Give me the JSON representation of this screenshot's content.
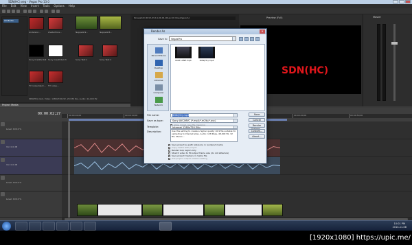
{
  "window": {
    "title": "SDN(HC).veg - Vegas Pro 13.0"
  },
  "menu": [
    "File",
    "Edit",
    "View",
    "Insert",
    "Tools",
    "Options",
    "Help"
  ],
  "media_panel": {
    "tree_selected": "All Media",
    "items": [
      {
        "label": "Anderson..."
      },
      {
        "label": "shadertone..."
      },
      {
        "label": "Neppelin9..."
      },
      {
        "label": "Neppelin8..."
      },
      {
        "label": "Sony Credits Roll"
      },
      {
        "label": "Sony Credit Roll 3"
      },
      {
        "label": "Sony Text 1"
      },
      {
        "label": "Sony Text 2"
      },
      {
        "label": "TV noise black..."
      },
      {
        "label": "TV noise..."
      }
    ],
    "status": "SDN(HC).mp4, Video: 1280x720x32, 29.970 fps, Audio: 44,100 Hz",
    "tabs": [
      "Explorer",
      "Transitions",
      "Video FX",
      "Media Generators"
    ],
    "title": "Project Media"
  },
  "trimmer": {
    "path": "[Snapshot] 2013-03-14-00-01-06.avi  [C:\\Users\\Jeson\\]"
  },
  "preview": {
    "label": "Preview (Full)",
    "overlay_text": "SDN(HC)",
    "overlay_color": "#e0161b"
  },
  "mixer": {
    "title": "Master"
  },
  "timeline": {
    "timecode": "00:00:02;27",
    "ruler": [
      "00:00:00;00",
      "00:00:10;00",
      "00:00:20;00",
      "00:00:30;00",
      "00:00:40;00",
      "00:00:50;00"
    ],
    "tracks": [
      {
        "kind": "video",
        "level": "Level: 100.0 %"
      },
      {
        "kind": "audio",
        "level": "Vol: 0.0 dB"
      },
      {
        "kind": "audio",
        "level": "Vol: 0.0 dB"
      },
      {
        "kind": "video",
        "level": "Level: 100.0 %"
      },
      {
        "kind": "video",
        "level": "Level: 100.0 %"
      }
    ],
    "record_time": "Record Time (2 channels): 244:15:36"
  },
  "dialog": {
    "title": "Render As",
    "save_in_label": "Save in:",
    "save_in_value": "VegasPro",
    "places": [
      "Recent Places",
      "Desktop",
      "Libraries",
      "Computer",
      "Network"
    ],
    "files": [
      {
        "name": "KOM LANE.mp4"
      },
      {
        "name": "SDN(HC).mp4"
      }
    ],
    "filename_label": "File name:",
    "filename_value": "SDN(HC).mp4",
    "saveas_label": "Save as type:",
    "saveas_value": "Sony AVC/MVC (*.mp4;*.m2ts;*.avc)",
    "allow_mixed": "Allow mixed-case file mapping",
    "template_label": "Template:",
    "template_value": "Internet 1280x720-30p",
    "description_label": "Description:",
    "description_text": "Use this setting to create a higher quality 16:9 file suitable for uploading to Internet sites. Audio: 128 Kbps, 48,000 Hz, 32 Bit, Stereo...",
    "buttons": [
      "Save",
      "Cancel",
      "Render Options...",
      "Custom...",
      "About..."
    ],
    "checkboxes": [
      {
        "label": "Save project as path reference in rendered media",
        "enabled": true
      },
      {
        "label": "Copy media with project",
        "enabled": false
      },
      {
        "label": "Render loop region only",
        "enabled": true
      },
      {
        "label": "Stretch video to fill output frame size (do not letterbox)",
        "enabled": true
      },
      {
        "label": "Save project markers in media file",
        "enabled": true
      },
      {
        "label": "Use project output rotation setting",
        "enabled": false
      }
    ]
  },
  "taskbar": {
    "time": "10:01 PM",
    "date": "2014-11-08"
  },
  "watermark": "[1920x1080] https://upic.me/"
}
